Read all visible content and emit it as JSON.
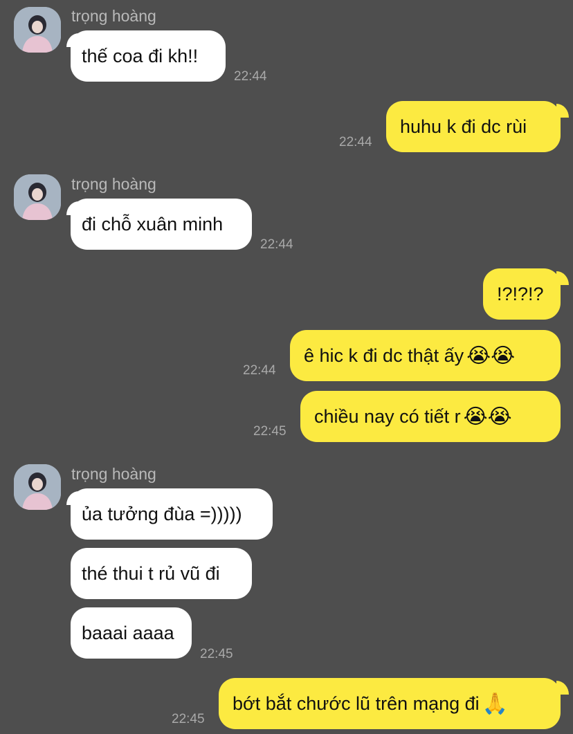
{
  "contact": {
    "name": "trọng hoàng"
  },
  "messages": [
    {
      "side": "in",
      "text": "thế coa đi kh!!",
      "time": "22:44"
    },
    {
      "side": "out",
      "text": "huhu k đi dc rùi",
      "time": "22:44"
    },
    {
      "side": "in",
      "text": "đi chỗ xuân minh",
      "time": "22:44"
    },
    {
      "side": "out",
      "text": "!?!?!?",
      "time": ""
    },
    {
      "side": "out",
      "text": "ê hic k đi dc thật ấy",
      "emoji": "😭😭",
      "time": "22:44"
    },
    {
      "side": "out",
      "text": "chiều nay có tiết r ",
      "emoji": "😭😭",
      "time": "22:45"
    },
    {
      "side": "in",
      "text": "ủa tưởng đùa =)))))",
      "time": ""
    },
    {
      "side": "in",
      "text": "thé thui t rủ vũ đi",
      "time": ""
    },
    {
      "side": "in",
      "text": "baaai aaaa",
      "time": "22:45"
    },
    {
      "side": "out",
      "text": "bớt bắt chước lũ trên mạng đi ",
      "emoji": "🙏",
      "time": "22:45"
    }
  ],
  "colors": {
    "background": "#4e4e4e",
    "outgoing": "#fcea41",
    "incoming": "#ffffff"
  },
  "icons": {
    "avatar": "contact-avatar-photo"
  }
}
